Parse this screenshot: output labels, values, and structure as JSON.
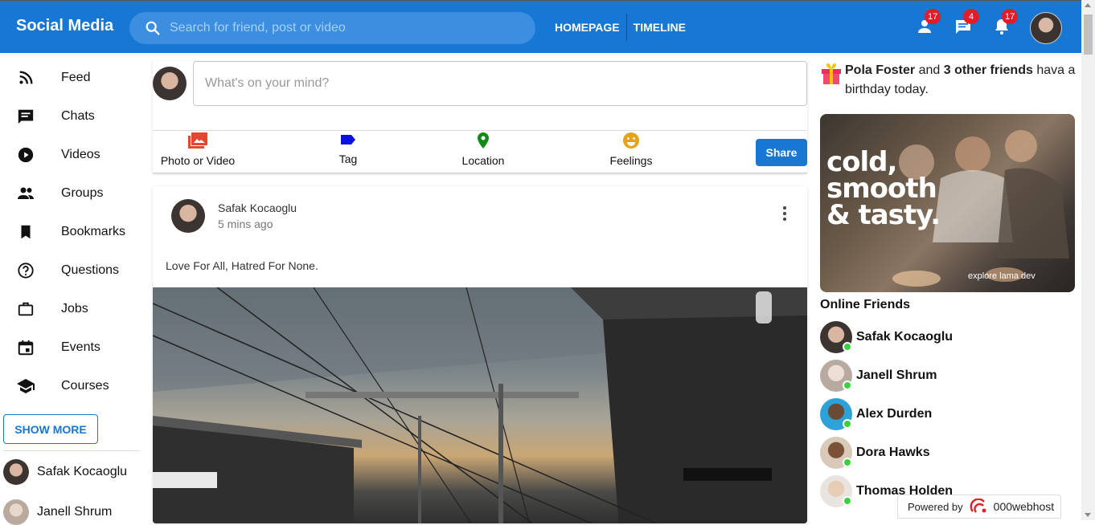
{
  "header": {
    "logo": "Social Media",
    "search_placeholder": "Search for friend, post or video",
    "links": [
      "HOMEPAGE",
      "TIMELINE"
    ],
    "badges": {
      "friend_requests": "17",
      "messages": "4",
      "notifications": "17"
    },
    "accent": "#1877d2"
  },
  "sidebar": {
    "items": [
      {
        "label": "Feed",
        "icon": "rss-feed-icon"
      },
      {
        "label": "Chats",
        "icon": "chat-icon"
      },
      {
        "label": "Videos",
        "icon": "play-circle-icon"
      },
      {
        "label": "Groups",
        "icon": "group-icon"
      },
      {
        "label": "Bookmarks",
        "icon": "bookmark-icon"
      },
      {
        "label": "Questions",
        "icon": "help-outline-icon"
      },
      {
        "label": "Jobs",
        "icon": "work-outline-icon"
      },
      {
        "label": "Events",
        "icon": "event-icon"
      },
      {
        "label": "Courses",
        "icon": "school-icon"
      }
    ],
    "show_more": "SHOW MORE",
    "friends": [
      "Safak Kocaoglu",
      "Janell Shrum"
    ]
  },
  "share": {
    "placeholder": "What's on your mind?",
    "options": [
      {
        "label": "Photo or Video",
        "icon": "photo-library-icon",
        "color": "#e0492d"
      },
      {
        "label": "Tag",
        "icon": "label-icon",
        "color": "#0b12e0"
      },
      {
        "label": "Location",
        "icon": "room-icon",
        "color": "#138a13"
      },
      {
        "label": "Feelings",
        "icon": "emoji-emotions-icon",
        "color": "#e4a31c"
      }
    ],
    "button": "Share"
  },
  "post": {
    "author": "Safak Kocaoglu",
    "time": "5 mins ago",
    "text": "Love For All, Hatred For None."
  },
  "rightbar": {
    "birthday_name": "Pola Foster",
    "birthday_and": " and ",
    "birthday_others": "3 other friends",
    "birthday_rest": " hava a birthday today.",
    "ad_line1": "cold,",
    "ad_line2": "smooth",
    "ad_line3": "& tasty.",
    "ad_footer": "explore lama dev",
    "online_title": "Online Friends",
    "online": [
      "Safak Kocaoglu",
      "Janell Shrum",
      "Alex Durden",
      "Dora Hawks",
      "Thomas Holden"
    ]
  },
  "powered": {
    "label": "Powered by",
    "brand": "000webhost"
  }
}
